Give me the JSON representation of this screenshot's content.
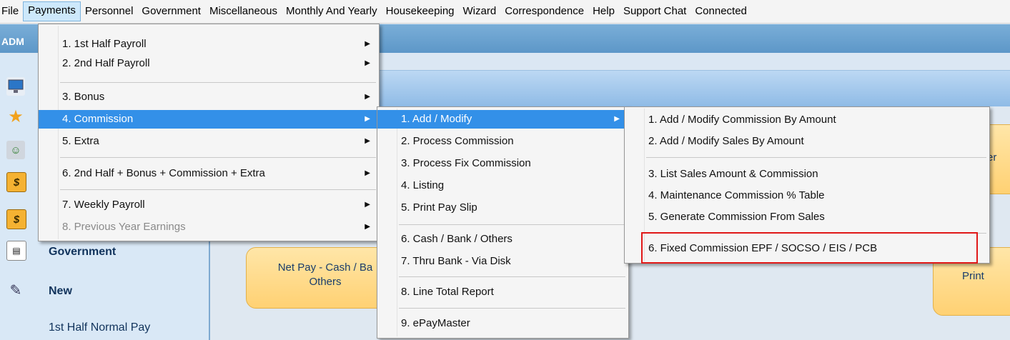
{
  "menubar": [
    "File",
    "Payments",
    "Personnel",
    "Government",
    "Miscellaneous",
    "Monthly And Yearly",
    "Housekeeping",
    "Wizard",
    "Correspondence",
    "Help",
    "Support Chat",
    "Connected"
  ],
  "app": {
    "title_fragment": "ADM",
    "sidebar": {
      "government": "Government",
      "new": "New",
      "normal_pay": "1st Half Normal Pay",
      "icons": [
        "monitor-icon",
        "star-icon",
        "people-icon",
        "dollar-icon",
        "dollar-icon"
      ]
    },
    "pills": {
      "netpay_line1": "Net Pay - Cash / Ba",
      "netpay_line2": "Others",
      "print_fragment": "Print",
      "right_fragment": "er"
    }
  },
  "payments_menu": [
    {
      "label": "1. 1st Half Payroll",
      "arrow": true
    },
    {
      "label": "2. 2nd Half Payroll",
      "arrow": true
    },
    {
      "label": "3. Bonus",
      "arrow": true
    },
    {
      "label": "4. Commission",
      "arrow": true,
      "highlight": true
    },
    {
      "label": "5. Extra",
      "arrow": true
    },
    {
      "label": "6. 2nd Half + Bonus + Commission + Extra",
      "arrow": true
    },
    {
      "label": "7. Weekly Payroll",
      "arrow": true
    },
    {
      "label": "8. Previous Year Earnings",
      "arrow": true,
      "disabled": true
    }
  ],
  "commission_menu": [
    {
      "label": "1. Add / Modify",
      "arrow": true,
      "highlight": true
    },
    {
      "label": "2. Process Commission"
    },
    {
      "label": "3. Process Fix Commission"
    },
    {
      "label": "4. Listing"
    },
    {
      "label": "5. Print Pay Slip"
    },
    {
      "label": "6. Cash / Bank / Others"
    },
    {
      "label": "7. Thru Bank - Via Disk"
    },
    {
      "label": "8. Line Total Report"
    },
    {
      "label": "9. ePayMaster"
    }
  ],
  "add_modify_menu": [
    {
      "label": "1. Add / Modify Commission By Amount"
    },
    {
      "label": "2. Add / Modify Sales By Amount"
    },
    {
      "label": "3. List Sales Amount & Commission"
    },
    {
      "label": "4. Maintenance Commission % Table"
    },
    {
      "label": "5. Generate Commission From Sales"
    },
    {
      "label": "6. Fixed Commission EPF / SOCSO / EIS / PCB",
      "callout": true
    }
  ],
  "colors": {
    "highlight": "#3390e8",
    "callout": "#e01818",
    "pill": "#ffd173"
  }
}
